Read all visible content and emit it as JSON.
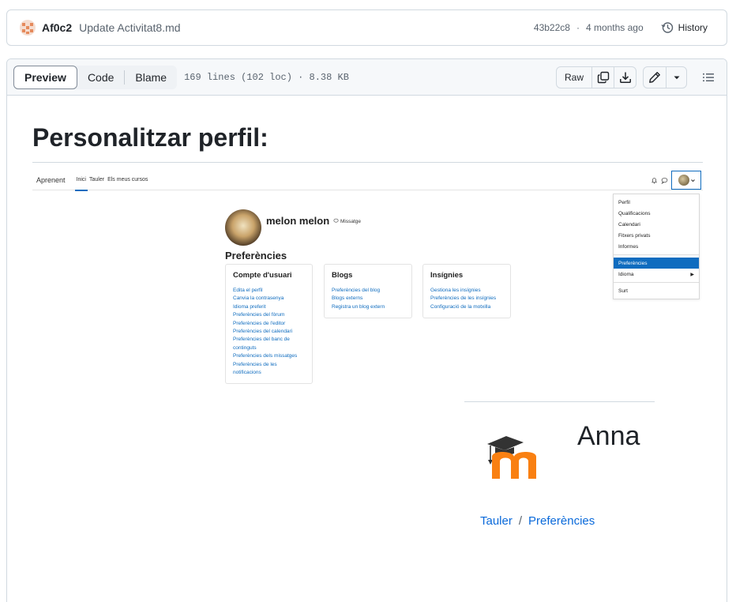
{
  "commit": {
    "author": "Af0c2",
    "message": "Update Activitat8.md",
    "hash": "43b22c8",
    "separator": "·",
    "time": "4 months ago",
    "history_label": "History"
  },
  "file_header": {
    "tabs": [
      "Preview",
      "Code",
      "Blame"
    ],
    "active_tab": "Preview",
    "info": "169 lines (102 loc) · 8.38 KB",
    "raw_label": "Raw"
  },
  "content": {
    "heading": "Personalitzar perfil:",
    "screenshot": {
      "brand": "Aprenent",
      "nav_links": [
        "Inici",
        "Tauler",
        "Els meus cursos"
      ],
      "user_menu": [
        "Perfil",
        "Qualificacions",
        "Calendari",
        "Fitxers privats",
        "Informes",
        "Preferències",
        "Idioma",
        "Surt"
      ],
      "user_menu_active": "Preferències",
      "user_name": "melon melon",
      "message_label": "Missatge",
      "preferences_title": "Preferències",
      "cards": [
        {
          "title": "Compte d'usuari",
          "links": [
            "Edita el perfil",
            "Canvia la contrasenya",
            "Idioma preferit",
            "Preferències del fòrum",
            "Preferències de l'editor",
            "Preferències del calendari",
            "Preferències del banc de",
            "continguts",
            "Preferències dels missatges",
            "Preferències de les",
            "notificacions"
          ]
        },
        {
          "title": "Blogs",
          "links": [
            "Preferències del blog",
            "Blogs externs",
            "Registra un blog extern"
          ]
        },
        {
          "title": "Insígnies",
          "links": [
            "Gestiona les insígnies",
            "Preferències de les insígnies",
            "Configuració de la motxilla"
          ]
        }
      ]
    },
    "logo_text": "Anna",
    "breadcrumb": [
      "Tauler",
      "Preferències"
    ],
    "breadcrumb_separator": "/"
  },
  "colors": {
    "link": "#0969da",
    "moodle_blue": "#0f6cbf",
    "moodle_orange": "#f98012",
    "border": "#d1d9e0"
  },
  "icons": [
    "history-icon",
    "copy-icon",
    "download-icon",
    "pencil-icon",
    "caret-down-icon",
    "list-icon",
    "bell-icon",
    "chat-icon"
  ]
}
